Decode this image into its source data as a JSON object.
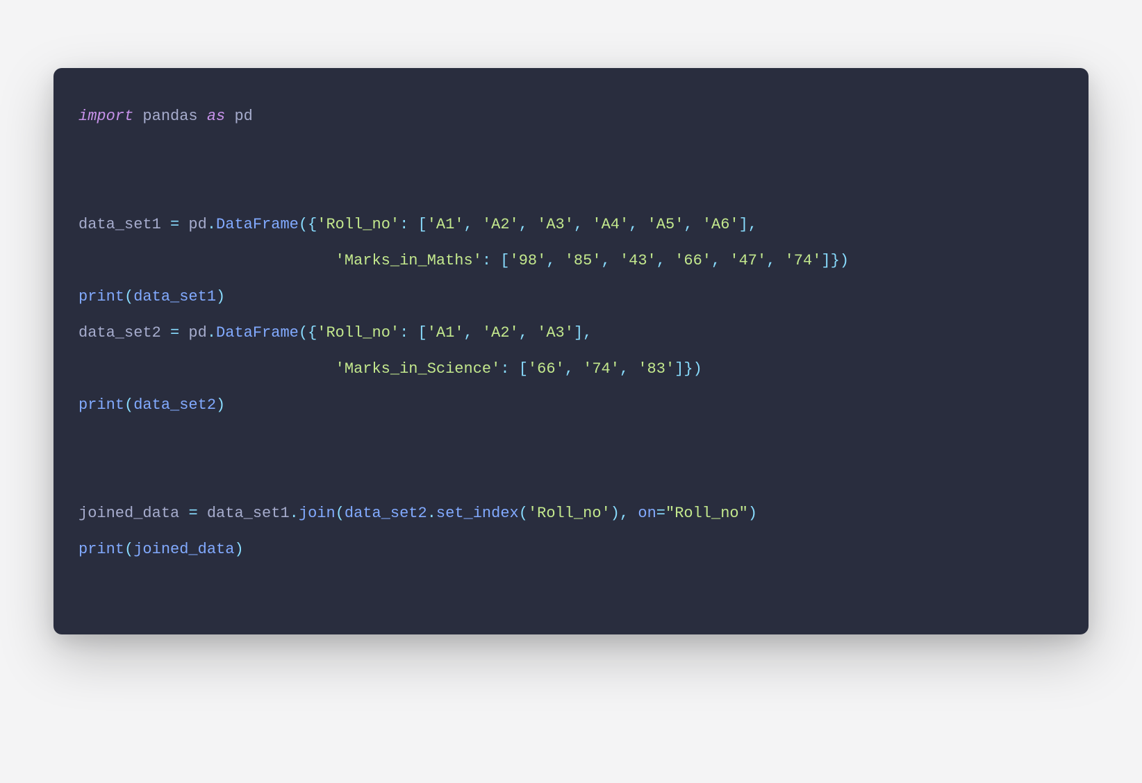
{
  "code": {
    "line1": {
      "kw_import": "import",
      "mod": " pandas ",
      "kw_as": "as",
      "alias": " pd"
    },
    "line4_a": "data_set1 ",
    "line4_eq": "=",
    "line4_b": " pd",
    "line4_dot1": ".",
    "line4_fn": "DataFrame",
    "line4_open": "({",
    "line4_key1": "'Roll_no'",
    "line4_colon": ":",
    "line4_lb": " [",
    "line4_v1": "'A1'",
    "line4_c": ", ",
    "line4_v2": "'A2'",
    "line4_v3": "'A3'",
    "line4_v4": "'A4'",
    "line4_v5": "'A5'",
    "line4_v6": "'A6'",
    "line4_rb": "],",
    "line5_pad": "                            ",
    "line5_key": "'Marks_in_Maths'",
    "line5_v1": "'98'",
    "line5_v2": "'85'",
    "line5_v3": "'43'",
    "line5_v4": "'66'",
    "line5_v5": "'47'",
    "line5_v6": "'74'",
    "line5_close": "]})",
    "line6_print": "print",
    "line6_arg": "data_set1",
    "line7_a": "data_set2 ",
    "line7_key1": "'Roll_no'",
    "line7_v1": "'A1'",
    "line7_v2": "'A2'",
    "line7_v3": "'A3'",
    "line8_key": "'Marks_in_Science'",
    "line8_v1": "'66'",
    "line8_v2": "'74'",
    "line8_v3": "'83'",
    "line9_arg": "data_set2",
    "line12_a": "joined_data ",
    "line12_b": " data_set1",
    "line12_join": "join",
    "line12_c": "data_set2",
    "line12_setidx": "set_index",
    "line12_roll": "'Roll_no'",
    "line12_on": " on",
    "line12_onval": "\"Roll_no\"",
    "line13_arg": "joined_data"
  }
}
